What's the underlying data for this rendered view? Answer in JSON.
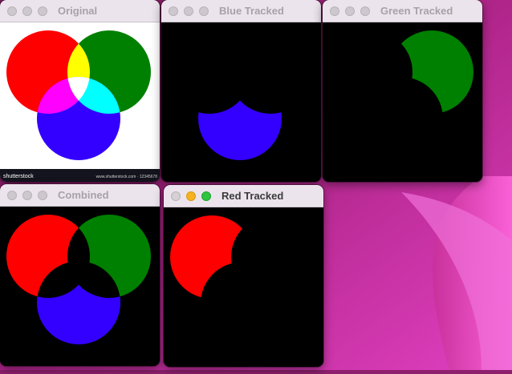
{
  "windows": {
    "original": {
      "title": "Original",
      "watermark_left": "shutterstock",
      "watermark_right": "www.shutterstock.com · 12345678"
    },
    "blue": {
      "title": "Blue Tracked"
    },
    "green": {
      "title": "Green Tracked"
    },
    "combined": {
      "title": "Combined"
    },
    "red": {
      "title": "Red Tracked"
    }
  },
  "colors": {
    "red": "#ff0000",
    "green": "#008000",
    "blue": "#3300ff",
    "yellow": "#ffff00",
    "magenta": "#ff00ff",
    "cyan": "#00ffff",
    "white": "#ffffff",
    "black": "#000000"
  },
  "icons": [
    "close-icon",
    "minimize-icon",
    "zoom-icon"
  ]
}
